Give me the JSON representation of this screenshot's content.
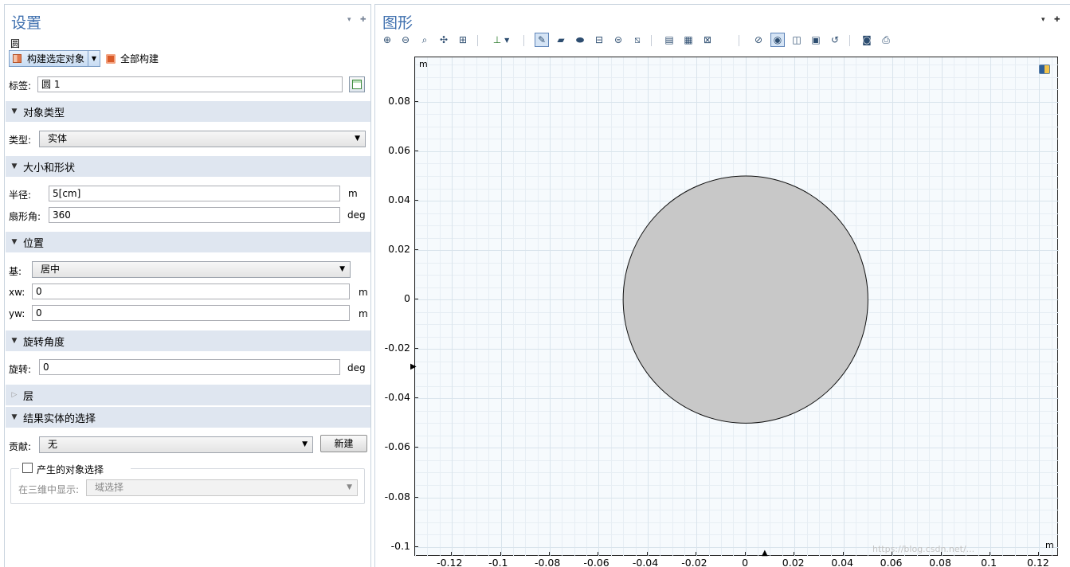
{
  "settings": {
    "title": "设置",
    "object_name": "圆",
    "build_selected_label": "构建选定对象",
    "build_all_label": "全部构建",
    "label_field": {
      "label": "标签:",
      "value": "圆 1"
    },
    "sections": {
      "object_type": "对象类型",
      "size_shape": "大小和形状",
      "position": "位置",
      "rotation_angle": "旋转角度",
      "layers": "层",
      "result_selection": "结果实体的选择"
    },
    "type_field": {
      "label": "类型:",
      "value": "实体"
    },
    "radius": {
      "label": "半径:",
      "value": "5[cm]",
      "unit": "m"
    },
    "sector_angle": {
      "label": "扇形角:",
      "value": "360",
      "unit": "deg"
    },
    "base": {
      "label": "基:",
      "value": "居中"
    },
    "xw": {
      "label": "xw:",
      "value": "0",
      "unit": "m"
    },
    "yw": {
      "label": "yw:",
      "value": "0",
      "unit": "m"
    },
    "rotation": {
      "label": "旋转:",
      "value": "0",
      "unit": "deg"
    },
    "contribute": {
      "label": "贡献:",
      "value": "无",
      "new_button": "新建"
    },
    "resulting_selection": {
      "checkbox_label": "产生的对象选择",
      "checked": false
    },
    "show_in_3d": {
      "label": "在三维中显示:",
      "value": "域选择"
    }
  },
  "graphics": {
    "title": "图形",
    "toolbar_icons": [
      "zoom-in-icon",
      "zoom-out-icon",
      "zoom-box-icon",
      "zoom-selected-icon",
      "zoom-extents-icon",
      "axis-orientation-icon",
      "select-objects-icon",
      "select-domains-icon",
      "select-boundaries-icon",
      "select-edges-icon",
      "select-points-icon",
      "clear-selection-icon",
      "build-geometry-icon",
      "delete-icon",
      "measure-icon",
      "hide-icon",
      "show-all-icon",
      "wireframe-icon",
      "transparency-icon",
      "reset-view-icon",
      "camera-icon",
      "print-icon"
    ],
    "corner_unit_top": "m",
    "corner_unit_bottom": "m",
    "watermark": "https://blog.csdn.net/...",
    "background_color": "#f6fafd",
    "circle_fill": "#c8c8c8"
  },
  "chart_data": {
    "type": "scatter",
    "shape": "circle",
    "center": [
      0,
      0
    ],
    "radius": 0.05,
    "xlim": [
      -0.135,
      0.128
    ],
    "ylim": [
      -0.104,
      0.098
    ],
    "x_ticks": [
      "-0.12",
      "-0.1",
      "-0.08",
      "-0.06",
      "-0.04",
      "-0.02",
      "0",
      "0.02",
      "0.04",
      "0.06",
      "0.08",
      "0.1",
      "0.12"
    ],
    "x_tick_values": [
      -0.12,
      -0.1,
      -0.08,
      -0.06,
      -0.04,
      -0.02,
      0,
      0.02,
      0.04,
      0.06,
      0.08,
      0.1,
      0.12
    ],
    "y_ticks": [
      "0.08",
      "0.06",
      "0.04",
      "0.02",
      "0",
      "-0.02",
      "-0.04",
      "-0.06",
      "-0.08",
      "-0.1"
    ],
    "y_tick_values": [
      0.08,
      0.06,
      0.04,
      0.02,
      0,
      -0.02,
      -0.04,
      -0.06,
      -0.08,
      -0.1
    ],
    "xlabel": "m",
    "ylabel": "m",
    "grid": true
  }
}
